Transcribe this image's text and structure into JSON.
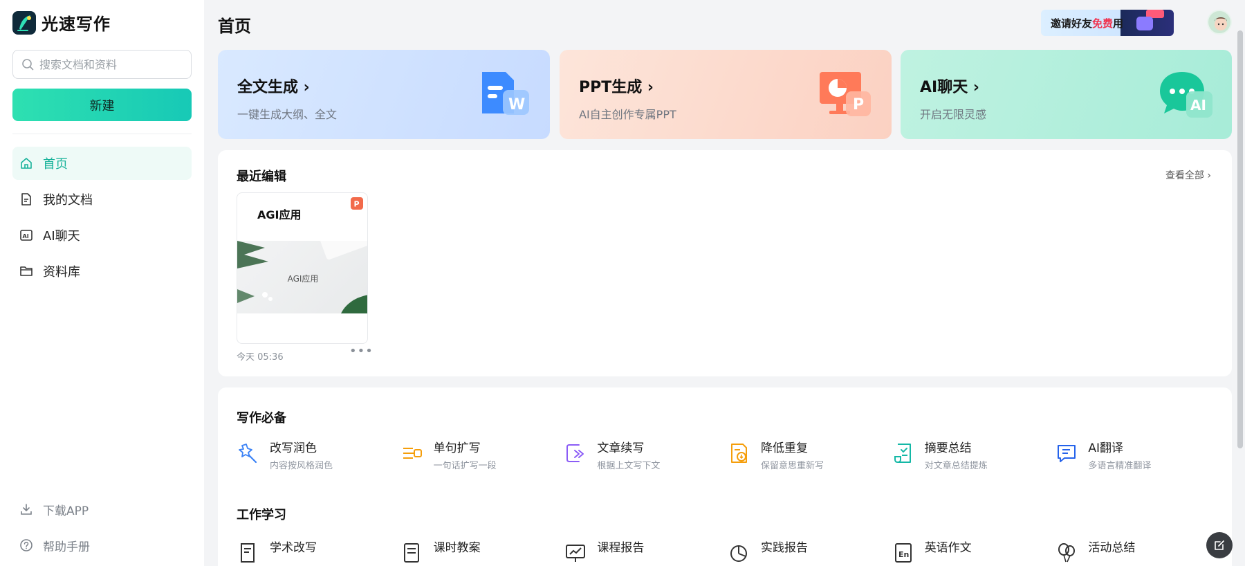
{
  "app": {
    "name": "光速写作"
  },
  "sidebar": {
    "search_placeholder": "搜索文档和资料",
    "new_label": "新建",
    "items": [
      {
        "label": "首页",
        "icon": "home-icon",
        "active": true
      },
      {
        "label": "我的文档",
        "icon": "document-icon",
        "active": false
      },
      {
        "label": "AI聊天",
        "icon": "ai-chat-icon",
        "active": false
      },
      {
        "label": "资料库",
        "icon": "folder-icon",
        "active": false
      }
    ],
    "bottom": [
      {
        "label": "下载APP",
        "icon": "download-icon"
      },
      {
        "label": "帮助手册",
        "icon": "help-icon"
      }
    ]
  },
  "header": {
    "title": "首页",
    "invite_prefix": "邀请好友",
    "invite_free": "免费",
    "invite_suffix": "用"
  },
  "cards": [
    {
      "title": "全文生成",
      "subtitle": "一键生成大纲、全文",
      "icon": "word-doc-icon"
    },
    {
      "title": "PPT生成",
      "subtitle": "AI自主创作专属PPT",
      "icon": "ppt-icon"
    },
    {
      "title": "AI聊天",
      "subtitle": "开启无限灵感",
      "icon": "ai-bubble-icon"
    }
  ],
  "recent": {
    "title": "最近编辑",
    "view_all": "查看全部",
    "docs": [
      {
        "title": "AGI应用",
        "thumb_text": "AGI应用",
        "time": "今天 05:36"
      }
    ]
  },
  "sections": [
    {
      "title": "写作必备",
      "tools": [
        {
          "name": "改写润色",
          "desc": "内容按风格润色",
          "icon": "magic-wand-icon",
          "color": "#3b82f6"
        },
        {
          "name": "单句扩写",
          "desc": "一句话扩写一段",
          "icon": "expand-icon",
          "color": "#f59e0b"
        },
        {
          "name": "文章续写",
          "desc": "根据上文写下文",
          "icon": "continue-icon",
          "color": "#8b5cf6"
        },
        {
          "name": "降低重复",
          "desc": "保留意思重新写",
          "icon": "reduce-icon",
          "color": "#f59e0b"
        },
        {
          "name": "摘要总结",
          "desc": "对文章总结提炼",
          "icon": "summary-icon",
          "color": "#14b8a6"
        },
        {
          "name": "AI翻译",
          "desc": "多语言精准翻译",
          "icon": "translate-icon",
          "color": "#2563eb"
        }
      ]
    },
    {
      "title": "工作学习",
      "tools": [
        {
          "name": "学术改写",
          "icon": "academic-icon"
        },
        {
          "name": "课时教案",
          "icon": "lesson-plan-icon"
        },
        {
          "name": "课程报告",
          "icon": "report-icon"
        },
        {
          "name": "实践报告",
          "icon": "pie-chart-icon"
        },
        {
          "name": "英语作文",
          "icon": "english-icon"
        },
        {
          "name": "活动总结",
          "icon": "balloon-icon"
        }
      ]
    }
  ]
}
